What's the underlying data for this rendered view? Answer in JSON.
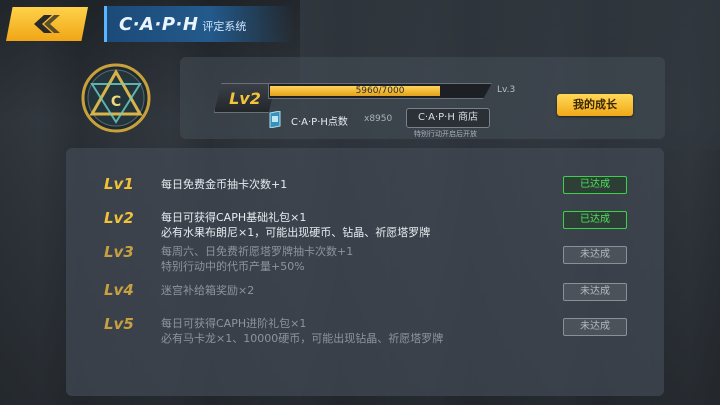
{
  "header": {
    "title": "C·A·P·H",
    "subtitle": "评定系统"
  },
  "emblem": {
    "text": "C·A·P·H"
  },
  "level": {
    "current": "Lv2",
    "exp_text": "5960/7000",
    "exp_fraction": 0.8514,
    "next": "Lv.3"
  },
  "points": {
    "label": "C·A·P·H点数",
    "value": "x8950"
  },
  "shop": {
    "label": "C·A·P·H 商店",
    "note": "特别行动开启后开放"
  },
  "growth_button": "我的成长",
  "rows": [
    {
      "lv": "Lv1",
      "line1": "每日免费金币抽卡次数+1",
      "line2": "",
      "status": "已达成",
      "achieved": true
    },
    {
      "lv": "Lv2",
      "line1": "每日可获得CAPH基础礼包×1",
      "line2": "必有水果布朗尼×1，可能出现硬币、钻晶、祈愿塔罗牌",
      "status": "已达成",
      "achieved": true
    },
    {
      "lv": "Lv3",
      "line1": "每周六、日免费祈愿塔罗牌抽卡次数+1",
      "line2": "特别行动中的代币产量+50%",
      "status": "未达成",
      "achieved": false
    },
    {
      "lv": "Lv4",
      "line1": "迷宫补给箱奖励×2",
      "line2": "",
      "status": "未达成",
      "achieved": false
    },
    {
      "lv": "Lv5",
      "line1": "每日可获得CAPH进阶礼包×1",
      "line2": "必有马卡龙×1、10000硬币，可能出现钻晶、祈愿塔罗牌",
      "status": "未达成",
      "achieved": false
    }
  ],
  "colors": {
    "accent": "#f0b020",
    "achieved": "#4fe05a",
    "title_blue": "#235a8c"
  }
}
